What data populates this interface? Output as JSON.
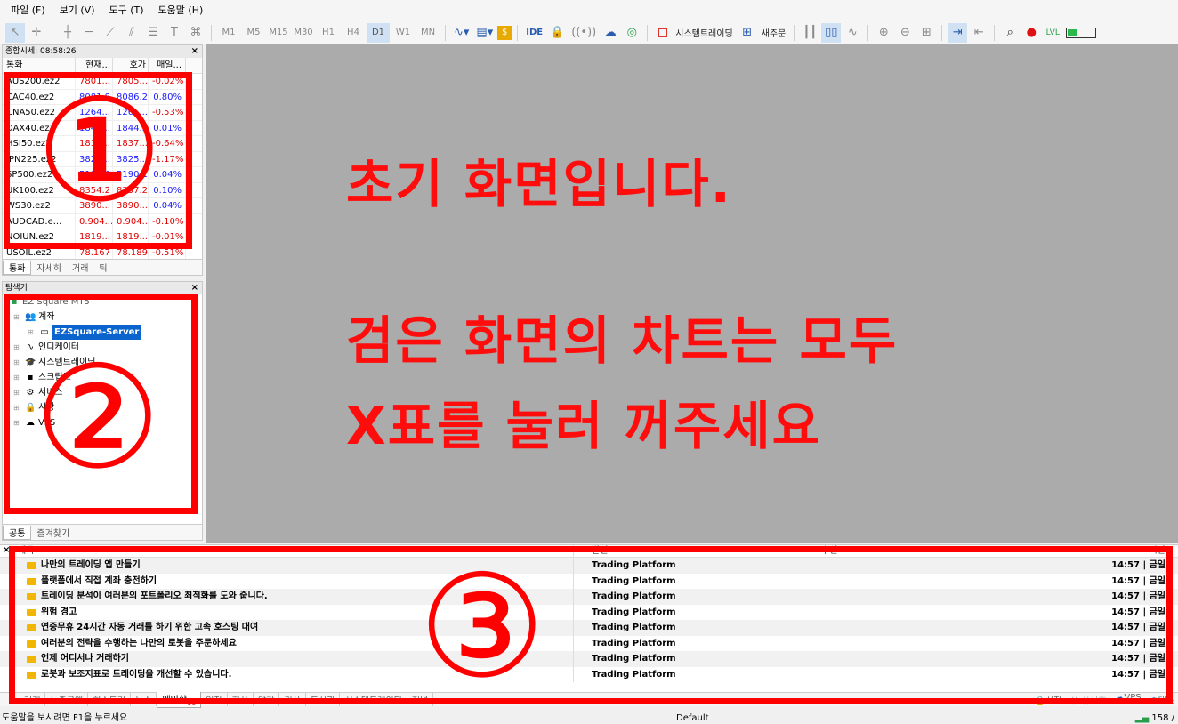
{
  "menu": [
    "파일 (F)",
    "보기 (V)",
    "도구 (T)",
    "도움말 (H)"
  ],
  "toolbar": {
    "timeframes": [
      "M1",
      "M5",
      "M15",
      "M30",
      "H1",
      "H4",
      "D1",
      "W1",
      "MN"
    ],
    "active_timeframe": "D1",
    "ide_label": "IDE",
    "systemtrading_label": "시스템트레이딩",
    "neworder_label": "새주문"
  },
  "market_watch": {
    "title": "종합시세: 08:58:26",
    "columns": [
      "통화",
      "현재...",
      "호가",
      "매일..."
    ],
    "rows": [
      {
        "symbol": "AUS200.ez2",
        "bid": "7801...",
        "ask": "7805...",
        "change": "-0.02%",
        "color": "#e00000"
      },
      {
        "symbol": "CAC40.ez2",
        "bid": "8081.8",
        "ask": "8086.2",
        "change": "0.80%",
        "color": "#1a1aff"
      },
      {
        "symbol": "CNA50.ez2",
        "bid": "1264...",
        "ask": "1265...",
        "change": "-0.53%",
        "color": "#1a1aff"
      },
      {
        "symbol": "DAX40.ez2",
        "bid": "1843...",
        "ask": "1844...",
        "change": "0.01%",
        "color": "#1a1aff"
      },
      {
        "symbol": "HSI50.ez2",
        "bid": "1836...",
        "ask": "1837...",
        "change": "-0.64%",
        "color": "#e00000"
      },
      {
        "symbol": "JPN225.ez2",
        "bid": "3824...",
        "ask": "3825...",
        "change": "-1.17%",
        "color": "#1a1aff"
      },
      {
        "symbol": "SP500.ez2",
        "bid": "5188.6",
        "ask": "5190.1",
        "change": "0.04%",
        "color": "#1a1aff"
      },
      {
        "symbol": "UK100.ez2",
        "bid": "8354.2",
        "ask": "8357.2",
        "change": "0.10%",
        "color": "#e00000"
      },
      {
        "symbol": "WS30.ez2",
        "bid": "3890...",
        "ask": "3890...",
        "change": "0.04%",
        "color": "#e00000"
      },
      {
        "symbol": "AUDCAD.e...",
        "bid": "0.904...",
        "ask": "0.904...",
        "change": "-0.10%",
        "color": "#e00000"
      },
      {
        "symbol": "NOIUN.ez2",
        "bid": "1819...",
        "ask": "1819...",
        "change": "-0.01%",
        "color": "#e00000"
      },
      {
        "symbol": "USOIL.ez2",
        "bid": "78.167",
        "ask": "78.189",
        "change": "-0.51%",
        "color": "#e00000"
      }
    ],
    "tabs": [
      "통화",
      "자세히",
      "거래",
      "틱"
    ]
  },
  "navigator": {
    "title": "탐색기",
    "root": "EZ Square MT5",
    "items": [
      {
        "label": "계좌",
        "icon": "accounts-icon",
        "glyph": "👥"
      },
      {
        "label": "EZSquare-Server",
        "icon": "server-icon",
        "glyph": "▭",
        "selected": true
      },
      {
        "label": "인디케이터",
        "icon": "indicator-icon",
        "glyph": "∿"
      },
      {
        "label": "시스템트레이딩",
        "icon": "systemtrading-icon",
        "glyph": "🎓"
      },
      {
        "label": "스크립트",
        "icon": "script-icon",
        "glyph": "▪"
      },
      {
        "label": "서비스",
        "icon": "service-icon",
        "glyph": "⚙"
      },
      {
        "label": "시장",
        "icon": "market-icon",
        "glyph": "🔒"
      },
      {
        "label": "VPS",
        "icon": "vps-icon",
        "glyph": "☁"
      }
    ],
    "tabs": [
      "공통",
      "즐겨찾기"
    ]
  },
  "chart_message": {
    "line1": "초기 화면입니다.",
    "line2": "검은 화면의 차트는 모두",
    "line3": "X표를 눌러 꺼주세요"
  },
  "terminal": {
    "columns": [
      "제목",
      "발신",
      "수신",
      "시간"
    ],
    "rows": [
      {
        "subject": "나만의 트레이딩 앱 만들기",
        "from": "Trading Platform",
        "time": "14:57 | 금일"
      },
      {
        "subject": "플랫폼에서 직접 계좌 충전하기",
        "from": "Trading Platform",
        "time": "14:57 | 금일"
      },
      {
        "subject": "트레이딩 분석이 여러분의 포트폴리오 최적화를 도와 줍니다.",
        "from": "Trading Platform",
        "time": "14:57 | 금일"
      },
      {
        "subject": "위험 경고",
        "from": "Trading Platform",
        "time": "14:57 | 금일"
      },
      {
        "subject": "연중무휴 24시간 자동 거래를 하기 위한 고속 호스팅 대여",
        "from": "Trading Platform",
        "time": "14:57 | 금일"
      },
      {
        "subject": "여러분의 전략을 수행하는 나만의 로봇을 주문하세요",
        "from": "Trading Platform",
        "time": "14:57 | 금일"
      },
      {
        "subject": "언제 어디서나 거래하기",
        "from": "Trading Platform",
        "time": "14:57 | 금일"
      },
      {
        "subject": "로봇과 보조지표로 트레이딩을 개선할 수 있습니다.",
        "from": "Trading Platform",
        "time": "14:57 | 금일"
      }
    ],
    "tabs": [
      "거래",
      "노출금액",
      "히스토리",
      "뉴스",
      "메일함",
      "일정",
      "회사",
      "알람",
      "기사",
      "도서관",
      "시스템트레이딩",
      "저널"
    ],
    "active_tab": "메일함",
    "mail_count": "11",
    "right_items": [
      "시장",
      "신호",
      "VPS",
      "테스"
    ]
  },
  "status": {
    "help": "도움말을 보시려면 F1을 누르세요",
    "profile": "Default",
    "traffic": "158 /"
  },
  "overlays": {
    "label1": "①",
    "label2": "②",
    "label3": "③",
    "color": "#ff0000"
  }
}
